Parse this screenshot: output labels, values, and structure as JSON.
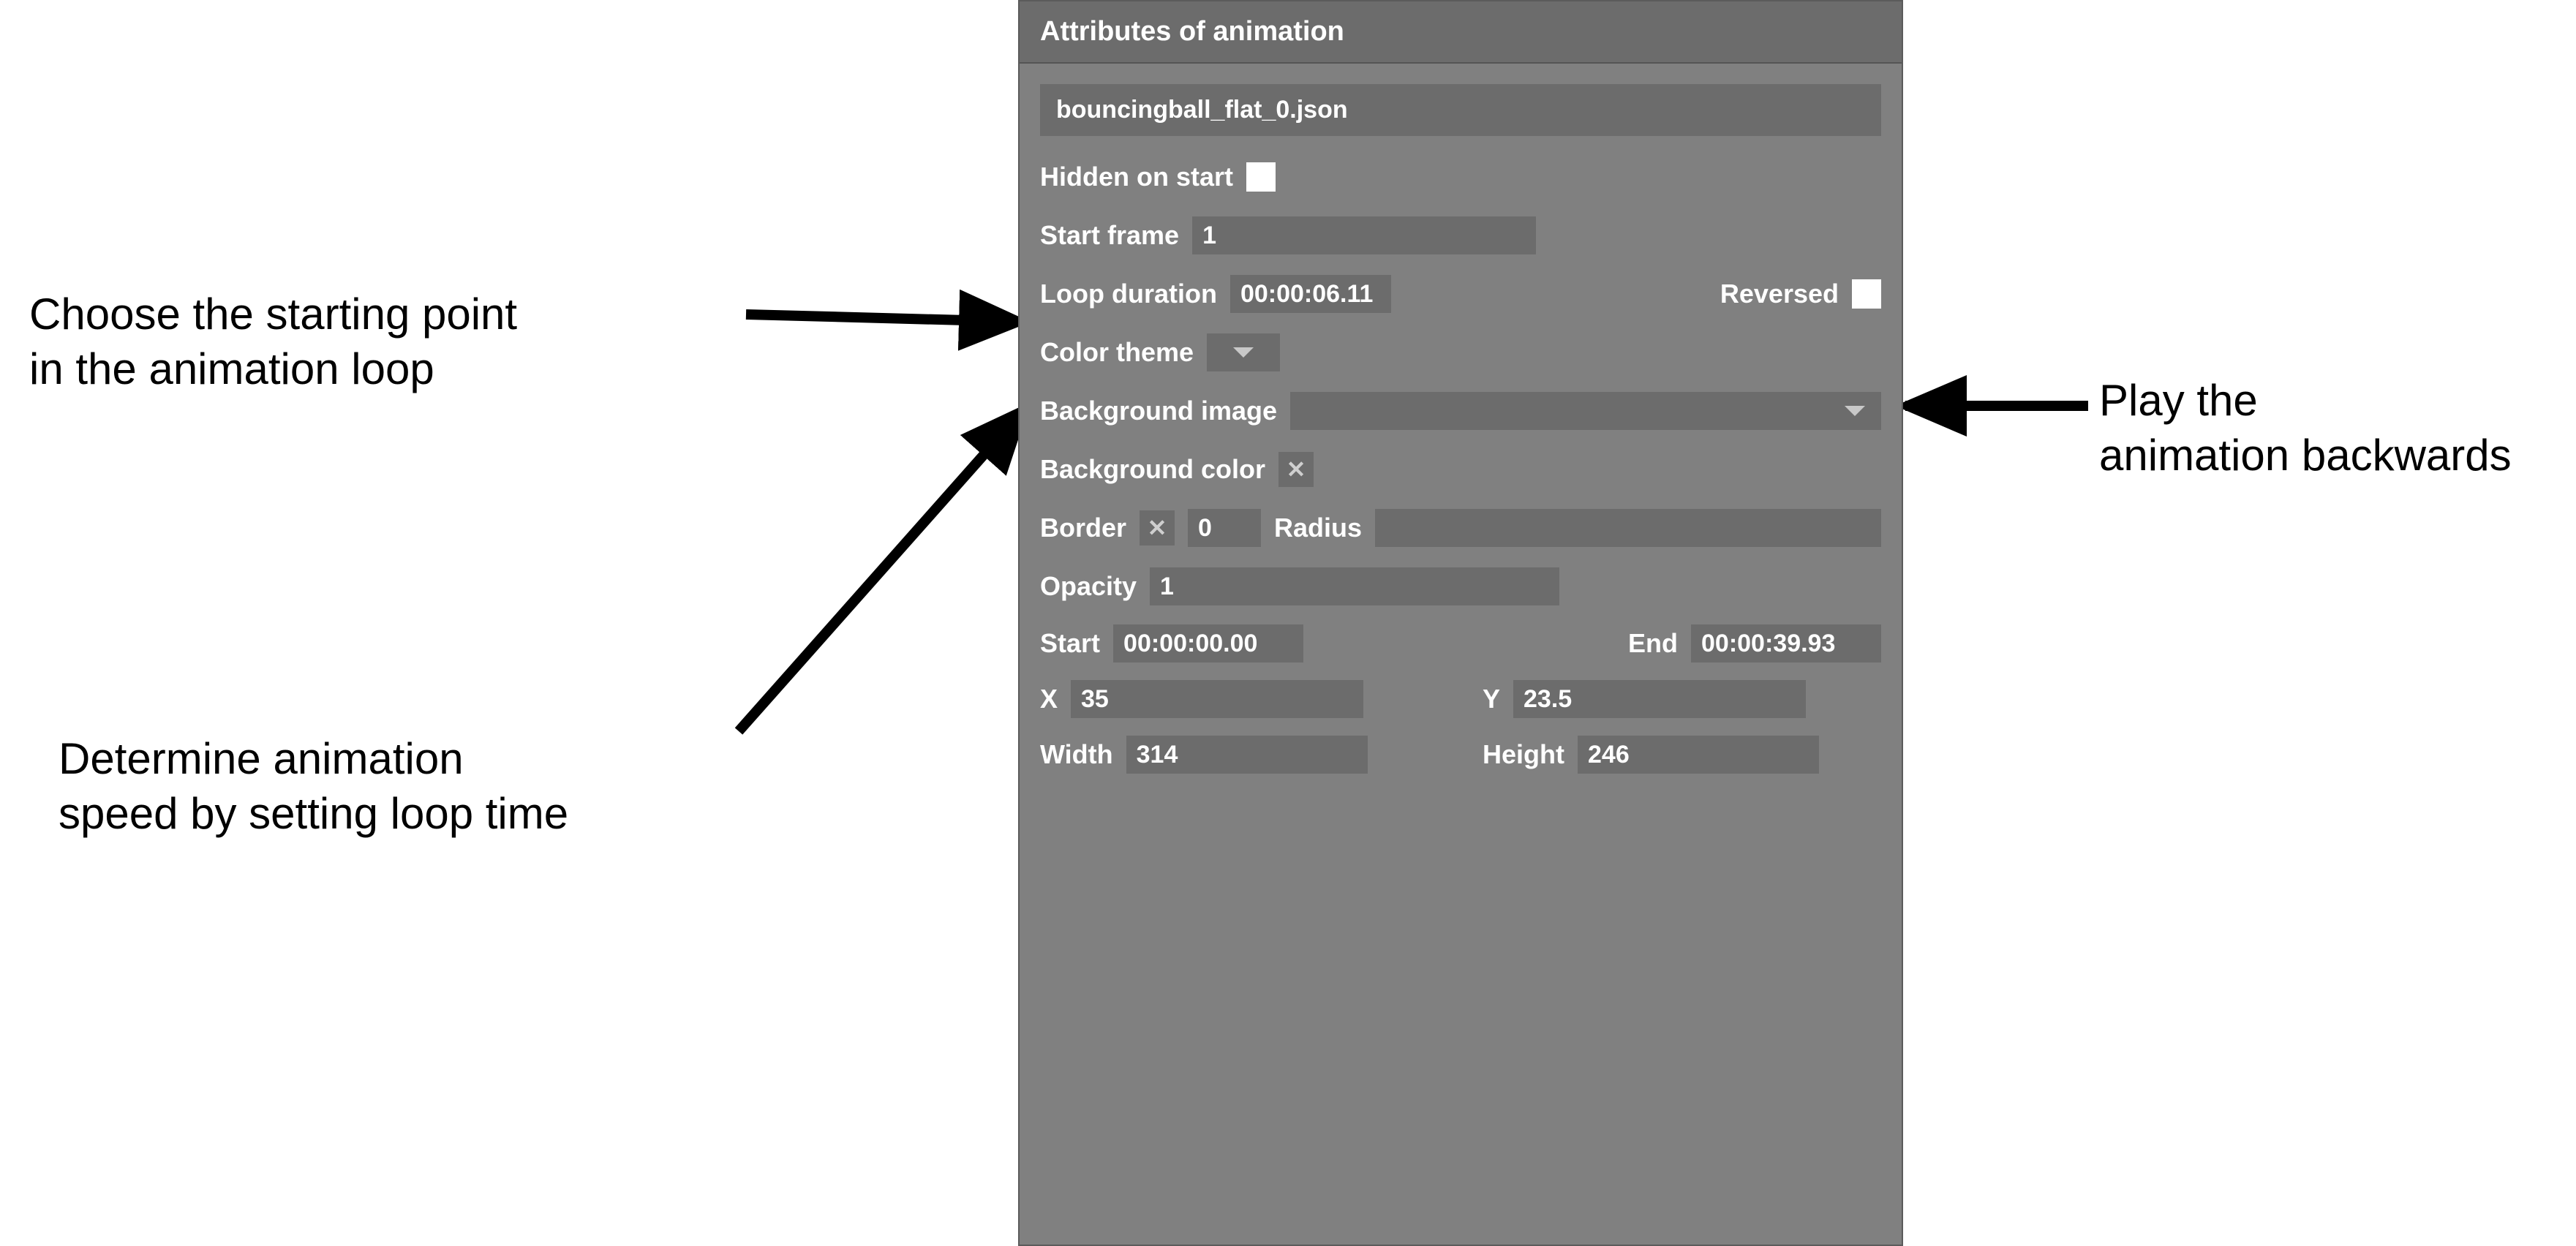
{
  "annotations": {
    "start_frame": "Choose the starting point\nin the animation loop",
    "loop_duration": "Determine animation\nspeed by setting loop time",
    "reversed": "Play the\nanimation backwards"
  },
  "panel": {
    "title": "Attributes of animation",
    "filename": "bouncingball_flat_0.json",
    "hidden_on_start": {
      "label": "Hidden on start",
      "checked": false
    },
    "start_frame": {
      "label": "Start frame",
      "value": "1"
    },
    "loop_duration": {
      "label": "Loop duration",
      "value": "00:00:06.11"
    },
    "reversed": {
      "label": "Reversed",
      "checked": false
    },
    "color_theme": {
      "label": "Color theme"
    },
    "background_image": {
      "label": "Background image"
    },
    "background_color": {
      "label": "Background color"
    },
    "border": {
      "label": "Border",
      "value": "0"
    },
    "radius": {
      "label": "Radius",
      "value": ""
    },
    "opacity": {
      "label": "Opacity",
      "value": "1"
    },
    "start": {
      "label": "Start",
      "value": "00:00:00.00"
    },
    "end": {
      "label": "End",
      "value": "00:00:39.93"
    },
    "x": {
      "label": "X",
      "value": "35"
    },
    "y": {
      "label": "Y",
      "value": "23.5"
    },
    "width": {
      "label": "Width",
      "value": "314"
    },
    "height": {
      "label": "Height",
      "value": "246"
    }
  }
}
